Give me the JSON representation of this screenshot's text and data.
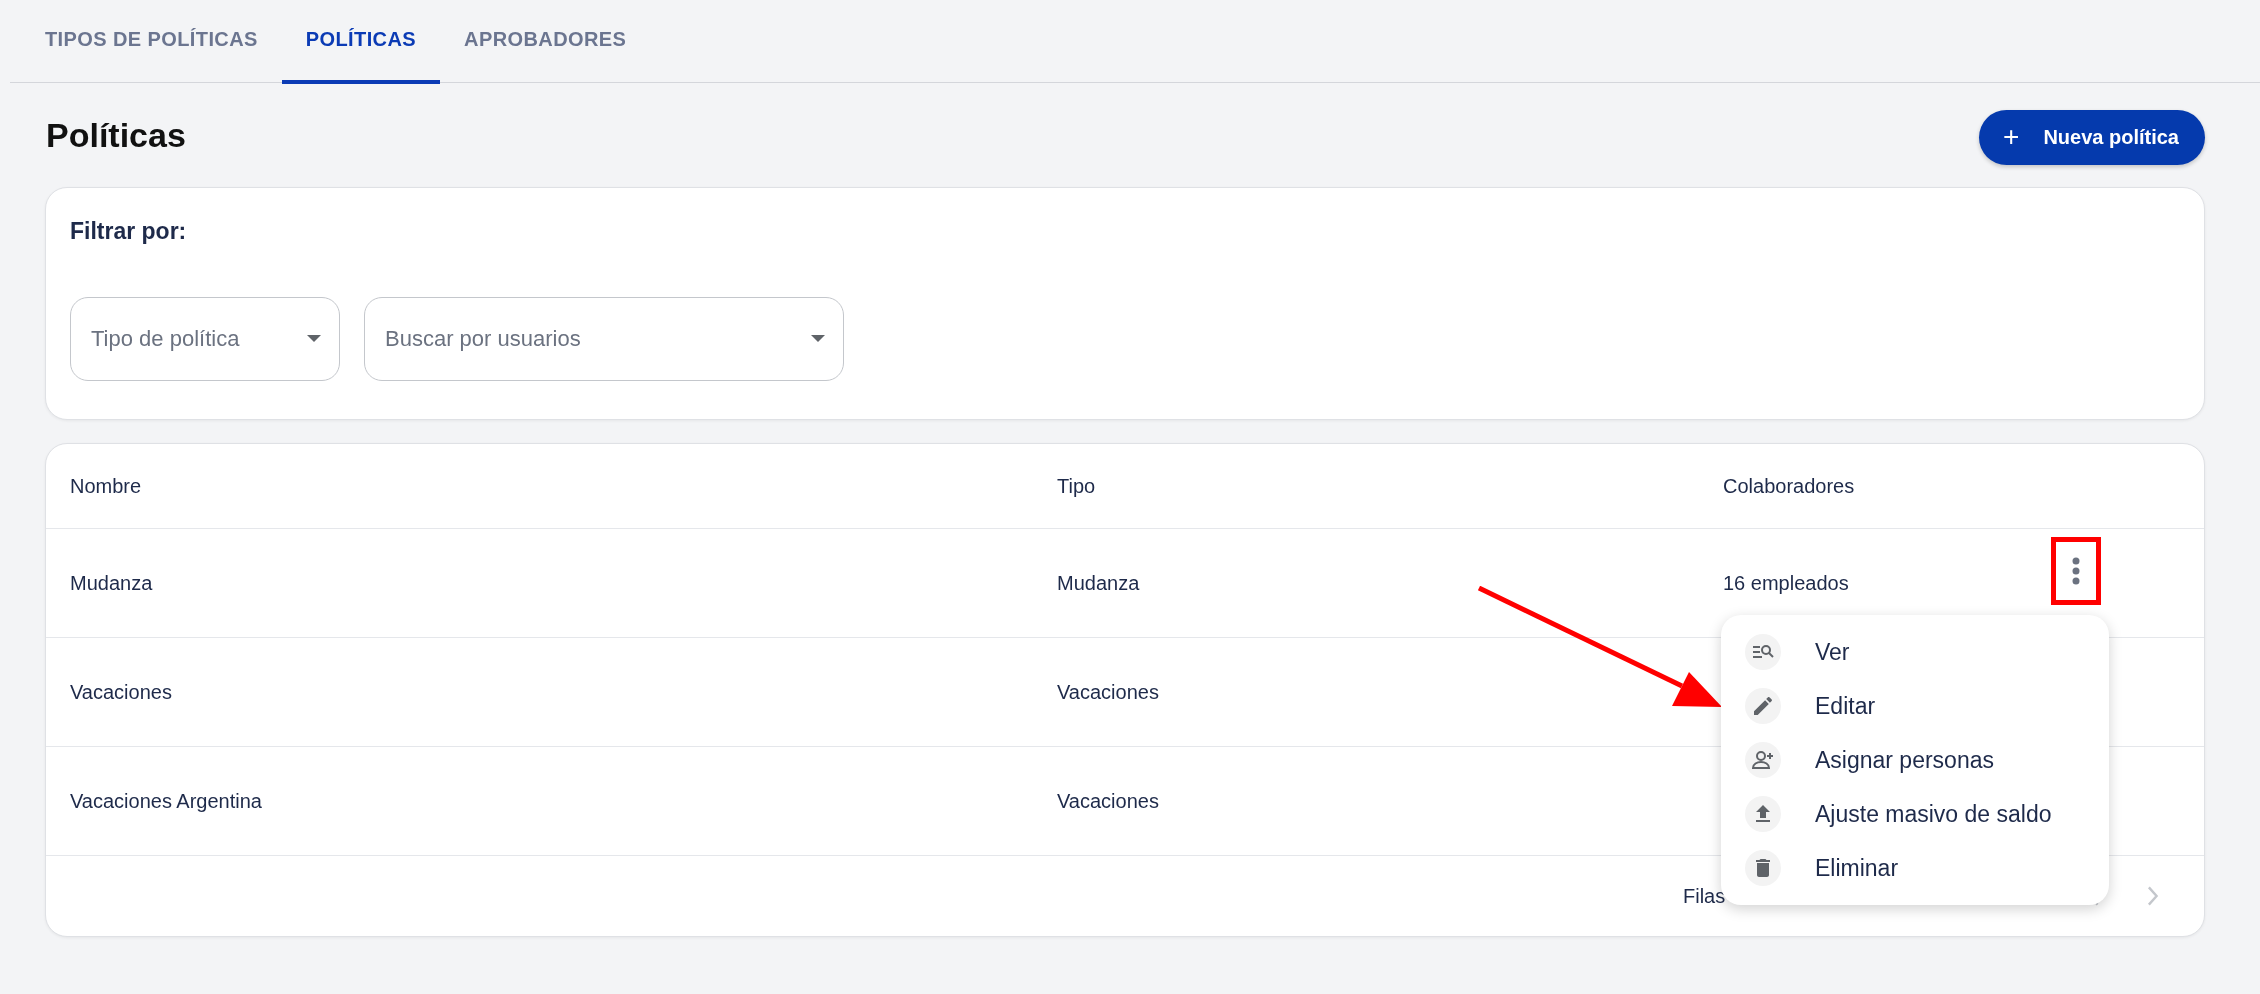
{
  "tabs": [
    {
      "label": "TIPOS DE POLÍTICAS",
      "selected": false
    },
    {
      "label": "POLÍTICAS",
      "selected": true
    },
    {
      "label": "APROBADORES",
      "selected": false
    }
  ],
  "page": {
    "title": "Políticas",
    "new_button": "Nueva política",
    "new_button_icon": "+"
  },
  "filter": {
    "title": "Filtrar por:",
    "fields": [
      {
        "placeholder": "Tipo de política"
      },
      {
        "placeholder": "Buscar por usuarios"
      }
    ]
  },
  "table": {
    "columns": [
      "Nombre",
      "Tipo",
      "Colaboradores"
    ],
    "rows": [
      {
        "cells": [
          "Mudanza",
          "Mudanza",
          "16 empleados"
        ],
        "menu_open": true
      },
      {
        "cells": [
          "Vacaciones",
          "Vacaciones",
          ""
        ],
        "menu_open": false
      },
      {
        "cells": [
          "Vacaciones Argentina",
          "Vacaciones",
          ""
        ],
        "menu_open": false
      }
    ],
    "footer": {
      "rows_label": "Filas"
    }
  },
  "menu": {
    "items": [
      {
        "label": "Ver",
        "kind": "view"
      },
      {
        "label": "Editar",
        "kind": "edit"
      },
      {
        "label": "Asignar personas",
        "kind": "assign"
      },
      {
        "label": "Ajuste masivo de saldo",
        "kind": "upload"
      },
      {
        "label": "Eliminar",
        "kind": "delete"
      }
    ]
  }
}
